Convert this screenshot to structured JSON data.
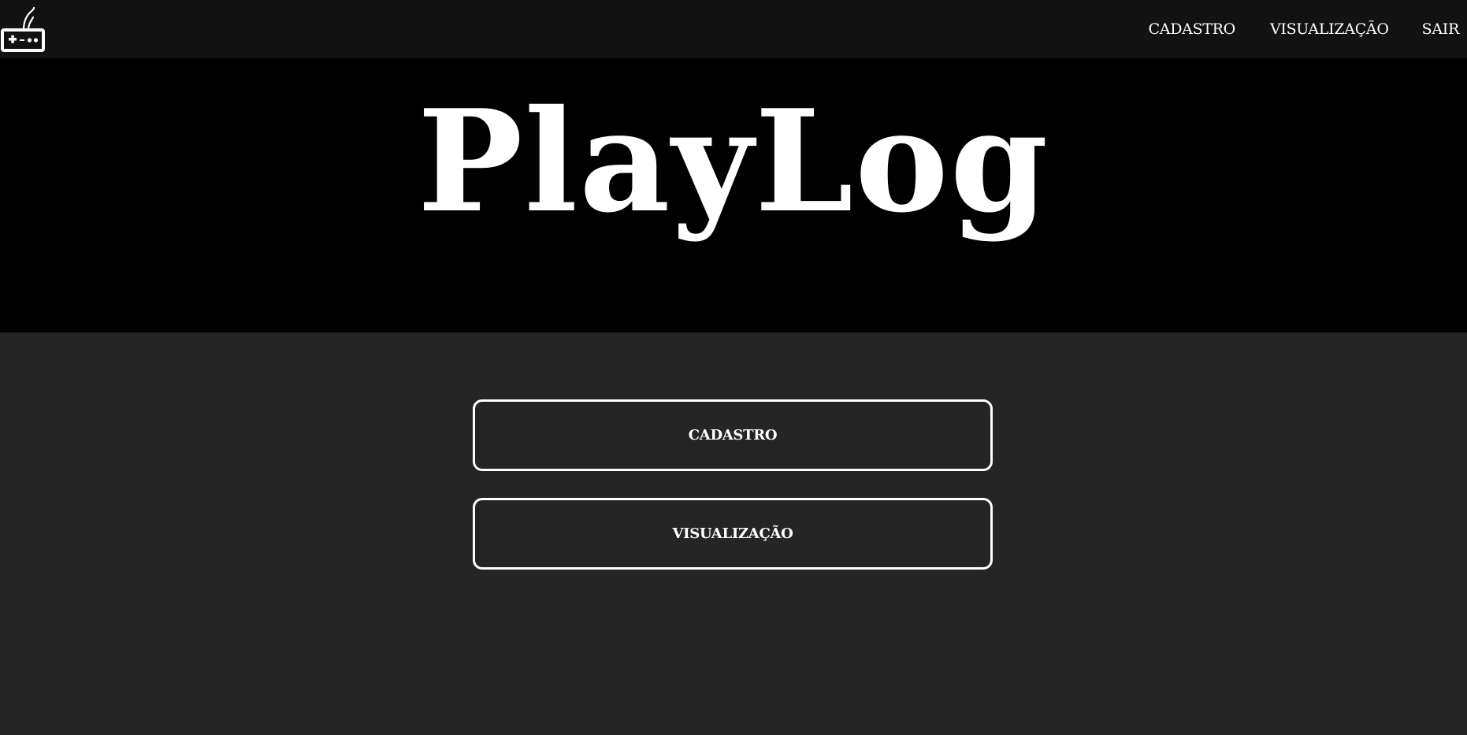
{
  "header": {
    "logo_icon": "gamepad-icon",
    "nav": {
      "cadastro": "CADASTRO",
      "visualizacao": "VISUALIZAÇÃO",
      "sair": "SAIR"
    }
  },
  "hero": {
    "title": "PlayLog"
  },
  "main": {
    "buttons": {
      "cadastro": "CADASTRO",
      "visualizacao": "VISUALIZAÇÃO"
    }
  },
  "colors": {
    "header_bg": "#121212",
    "hero_bg": "#000000",
    "page_bg": "#252525",
    "text": "#ffffff"
  }
}
